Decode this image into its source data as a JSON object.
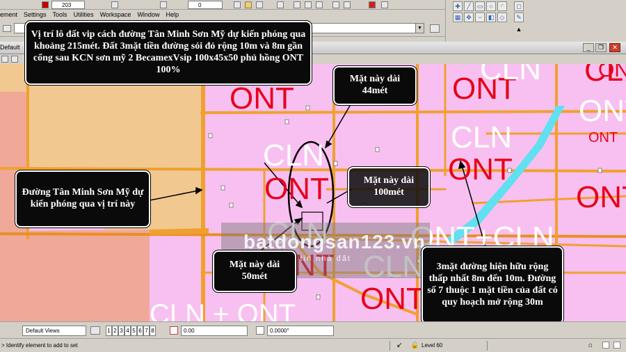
{
  "menu": {
    "items": [
      "ement",
      "Settings",
      "Tools",
      "Utilities",
      "Workspace",
      "Window",
      "Help"
    ]
  },
  "toolbar": {
    "top_combo_value": "203",
    "style_combo_value": "0"
  },
  "view": {
    "title": "Default"
  },
  "map": {
    "zones": [
      {
        "text": "ONT",
        "color": "red"
      },
      {
        "text": "CLN",
        "color": "red"
      },
      {
        "text": "ONT",
        "color": "red"
      },
      {
        "text": "CLN",
        "color": "white"
      },
      {
        "text": "ONT",
        "color": "red"
      },
      {
        "text": "ONT",
        "color": "white"
      },
      {
        "text": "CLN",
        "color": "white"
      },
      {
        "text": "ONT",
        "color": "red"
      },
      {
        "text": "ONT",
        "color": "red"
      },
      {
        "text": "ONT",
        "color": "red"
      },
      {
        "text": "CLN",
        "color": "white"
      },
      {
        "text": "ONT",
        "color": "red"
      },
      {
        "text": "CLN",
        "color": "white"
      },
      {
        "text": "ONT",
        "color": "red"
      },
      {
        "text": "ONT+CLN",
        "color": "white"
      },
      {
        "text": "CLN",
        "color": "white"
      },
      {
        "text": "ONT",
        "color": "red"
      },
      {
        "text": "CLN + ONT",
        "color": "white"
      }
    ],
    "watermark_main": "batdongsan123.vn",
    "watermark_sub": "kênh thông tin nhà đất"
  },
  "callouts": {
    "top": "Vị trí lô đất vip cách đường Tân Minh Sơn Mỹ dự kiến phóng qua khoảng 215mét. Đất 3mặt tiền đường sỏi đỏ rộng 10m và 8m gần cổng sau KCN sơn mỹ 2 BecamexVsip 100x45x50 phủ hồng ONT 100%",
    "side_44": "Mặt này dài 44mét",
    "road": "Đường Tân Minh Sơn Mỹ dự kiến phóng qua vị trí này",
    "side_100": "Mặt này dài 100mét",
    "side_50": "Mặt này dài 50mét",
    "roads_info": "3mặt đường hiện hữu rộng thấp nhất 8m đến 10m. Đường số 7 thuộc 1 mặt tiền của đất có quy hoạch mở rộng 30m"
  },
  "bottom": {
    "views_combo": "Default Views",
    "view_numbers": [
      "1",
      "2",
      "3",
      "4",
      "5",
      "6",
      "7",
      "8"
    ],
    "field_value": "0.00",
    "angle_value": "0.0000°"
  },
  "status": {
    "message": "> Identify element to add to set",
    "level": "Level 60"
  },
  "colors": {
    "land_pink": "#f8c0f0",
    "road_orange": "#f0a030",
    "zone_red": "#e8001a",
    "river_blue": "#60e0f0",
    "land_salmon": "#f0a898",
    "land_tan": "#f0c890"
  }
}
